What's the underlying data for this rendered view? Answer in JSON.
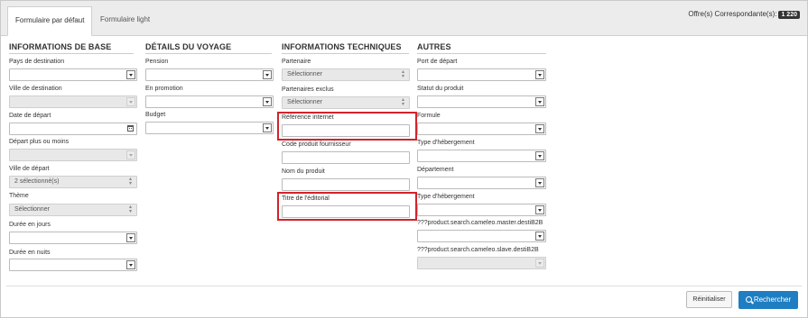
{
  "tabs": [
    {
      "label": "Formulaire par défaut",
      "active": true
    },
    {
      "label": "Formulaire light",
      "active": false
    }
  ],
  "offers": {
    "label": "Offre(s) Correspondante(s):",
    "count": "1 220"
  },
  "columns": {
    "base": {
      "title": "INFORMATIONS DE BASE",
      "pays_label": "Pays de destination",
      "ville_label": "Ville de destination",
      "date_label": "Date de départ",
      "depart_plus_label": "Départ plus ou moins",
      "ville_depart_label": "Ville de départ",
      "ville_depart_value": "2 sélectionné(s)",
      "theme_label": "Thème",
      "theme_value": "Sélectionner",
      "duree_jours_label": "Durée en jours",
      "duree_nuits_label": "Durée en nuits"
    },
    "voyage": {
      "title": "DÉTAILS DU VOYAGE",
      "pension_label": "Pension",
      "promotion_label": "En promotion",
      "budget_label": "Budget"
    },
    "tech": {
      "title": "INFORMATIONS TECHNIQUES",
      "partenaire_label": "Partenaire",
      "partenaire_value": "Sélectionner",
      "partenaires_exclus_label": "Partenaires exclus",
      "partenaires_exclus_value": "Sélectionner",
      "reference_label": "Référence internet",
      "code_label": "Code produit fournisseur",
      "nom_label": "Nom du produit",
      "titre_label": "Titre de l'éditorial"
    },
    "autres": {
      "title": "AUTRES",
      "port_label": "Port de départ",
      "statut_label": "Statut du produit",
      "formule_label": "Formule",
      "type_heb1_label": "Type d'hébergement",
      "departement_label": "Département",
      "type_heb2_label": "Type d'hébergement",
      "master_label": "???product.search.cameleo.master.destiB2B",
      "slave_label": "???product.search.cameleo.slave.destiB2B"
    }
  },
  "buttons": {
    "reset": "Réinitialiser",
    "search": "Rechercher"
  },
  "colors": {
    "highlight": "#d2232a",
    "primary": "#1f7ec2"
  }
}
